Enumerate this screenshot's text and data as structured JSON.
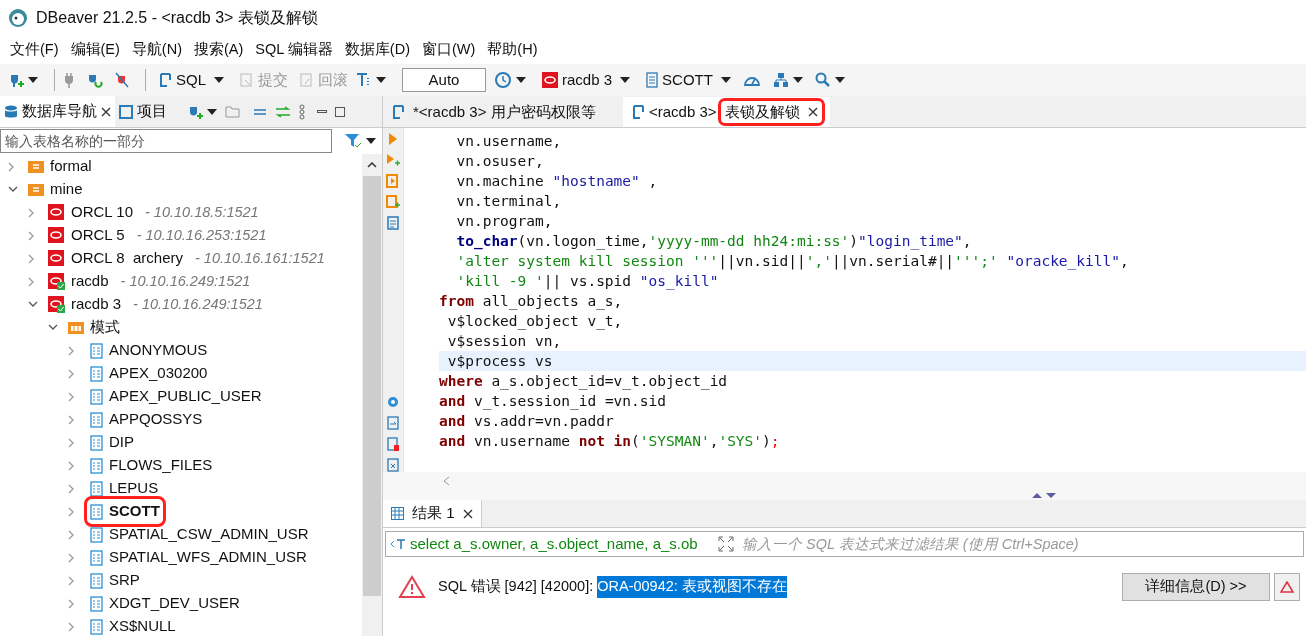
{
  "window": {
    "title": "DBeaver 21.2.5 - <racdb 3> 表锁及解锁"
  },
  "menu": [
    "文件(F)",
    "编辑(E)",
    "导航(N)",
    "搜索(A)",
    "SQL 编辑器",
    "数据库(D)",
    "窗口(W)",
    "帮助(H)"
  ],
  "toolbar": [
    {
      "kind": "icon",
      "dropdown": true
    },
    {
      "kind": "separator"
    },
    {
      "kind": "icon",
      "dropdown": false
    },
    {
      "kind": "icon",
      "dropdown": false
    },
    {
      "kind": "icon",
      "dropdown": false
    },
    {
      "kind": "separator"
    },
    {
      "kind": "button",
      "label": "SQL",
      "disabled": false,
      "dropdown": true
    },
    {
      "kind": "button",
      "label": "提交",
      "disabled": true,
      "dropdown": false
    },
    {
      "kind": "button",
      "label": "回滚",
      "disabled": true,
      "dropdown": false
    },
    {
      "kind": "icon",
      "dropdown": true
    },
    {
      "kind": "field",
      "label": "Auto"
    },
    {
      "kind": "icon",
      "dropdown": true
    },
    {
      "kind": "button",
      "label": "racdb 3",
      "disabled": false,
      "dropdown": true
    },
    {
      "kind": "button",
      "label": "SCOTT",
      "disabled": false,
      "dropdown": true
    },
    {
      "kind": "icon",
      "dropdown": false
    },
    {
      "kind": "icon",
      "dropdown": true
    },
    {
      "kind": "icon",
      "dropdown": true
    }
  ],
  "navigator": {
    "tabs": [
      {
        "label": "数据库导航",
        "selected": true
      },
      {
        "label": "项目",
        "selected": false
      }
    ],
    "filter": {
      "placeholder": "输入表格名称的一部分"
    },
    "tree": [
      {
        "kind": "folder",
        "label": "formal",
        "expanded": false
      },
      {
        "kind": "folder",
        "label": "mine",
        "expanded": true,
        "children": [
          {
            "kind": "connection",
            "label": "ORCL 10",
            "detail": "- 10.10.18.5:1521",
            "connected": false,
            "expanded": false
          },
          {
            "kind": "connection",
            "label": "ORCL 5",
            "detail": "- 10.10.16.253:1521",
            "connected": false,
            "expanded": false
          },
          {
            "kind": "connection",
            "label": "ORCL 8  archery",
            "detail": "- 10.10.16.161:1521",
            "connected": false,
            "expanded": false
          },
          {
            "kind": "connection",
            "label": "racdb",
            "detail": "- 10.10.16.249:1521",
            "connected": true,
            "expanded": false
          },
          {
            "kind": "connection",
            "label": "racdb 3",
            "detail": "- 10.10.16.249:1521",
            "connected": true,
            "expanded": true,
            "children": [
              {
                "kind": "schemas",
                "label": "模式",
                "expanded": true,
                "children": [
                  {
                    "kind": "schema",
                    "label": "ANONYMOUS",
                    "selected": false,
                    "highlighted": false
                  },
                  {
                    "kind": "schema",
                    "label": "APEX_030200",
                    "selected": false,
                    "highlighted": false
                  },
                  {
                    "kind": "schema",
                    "label": "APEX_PUBLIC_USER",
                    "selected": false,
                    "highlighted": false
                  },
                  {
                    "kind": "schema",
                    "label": "APPQOSSYS",
                    "selected": false,
                    "highlighted": false
                  },
                  {
                    "kind": "schema",
                    "label": "DIP",
                    "selected": false,
                    "highlighted": false
                  },
                  {
                    "kind": "schema",
                    "label": "FLOWS_FILES",
                    "selected": false,
                    "highlighted": false
                  },
                  {
                    "kind": "schema",
                    "label": "LEPUS",
                    "selected": false,
                    "highlighted": false
                  },
                  {
                    "kind": "schema",
                    "label": "SCOTT",
                    "selected": true,
                    "highlighted": true
                  },
                  {
                    "kind": "schema",
                    "label": "SPATIAL_CSW_ADMIN_USR",
                    "selected": false,
                    "highlighted": false
                  },
                  {
                    "kind": "schema",
                    "label": "SPATIAL_WFS_ADMIN_USR",
                    "selected": false,
                    "highlighted": false
                  },
                  {
                    "kind": "schema",
                    "label": "SRP",
                    "selected": false,
                    "highlighted": false
                  },
                  {
                    "kind": "schema",
                    "label": "XDGT_DEV_USER",
                    "selected": false,
                    "highlighted": false
                  },
                  {
                    "kind": "schema",
                    "label": "XS$NULL",
                    "selected": false,
                    "highlighted": false
                  }
                ]
              }
            ]
          }
        ]
      }
    ]
  },
  "editor_tabs": [
    {
      "label": "*<racdb 3> 用户密码权限等",
      "selected": false,
      "highlighted": false
    },
    {
      "label": "<racdb 3>",
      "label_2": "表锁及解锁",
      "selected": true,
      "highlighted": true
    }
  ],
  "code": [
    {
      "current": false,
      "segments": [
        {
          "kind": "plain",
          "text": "  vn.username,"
        }
      ]
    },
    {
      "current": false,
      "segments": [
        {
          "kind": "plain",
          "text": "  vn.osuser,"
        }
      ]
    },
    {
      "current": false,
      "segments": [
        {
          "kind": "plain",
          "text": "  vn.machine "
        },
        {
          "kind": "quoted",
          "text": "\"hostname\""
        },
        {
          "kind": "plain",
          "text": " ,"
        }
      ]
    },
    {
      "current": false,
      "segments": [
        {
          "kind": "plain",
          "text": "  vn.terminal,"
        }
      ]
    },
    {
      "current": false,
      "segments": [
        {
          "kind": "plain",
          "text": "  vn.program,"
        }
      ]
    },
    {
      "current": false,
      "segments": [
        {
          "kind": "function",
          "text": "  to_char"
        },
        {
          "kind": "plain",
          "text": "(vn.logon_time,"
        },
        {
          "kind": "string",
          "text": "'yyyy-mm-dd hh24:mi:ss'"
        },
        {
          "kind": "plain",
          "text": ")"
        },
        {
          "kind": "quoted",
          "text": "\"login_time\""
        },
        {
          "kind": "plain",
          "text": ","
        }
      ]
    },
    {
      "current": false,
      "segments": [
        {
          "kind": "string",
          "text": "  'alter system kill session '''"
        },
        {
          "kind": "plain",
          "text": "||vn.sid||"
        },
        {
          "kind": "string",
          "text": "','"
        },
        {
          "kind": "plain",
          "text": "||vn.serial#||"
        },
        {
          "kind": "string",
          "text": "''';'"
        },
        {
          "kind": "quoted",
          "text": " \"oracke_kill\""
        },
        {
          "kind": "plain",
          "text": ","
        }
      ]
    },
    {
      "current": false,
      "segments": [
        {
          "kind": "string",
          "text": "  'kill -9 '"
        },
        {
          "kind": "plain",
          "text": "|| vs.spid "
        },
        {
          "kind": "quoted",
          "text": "\"os_kill\""
        }
      ]
    },
    {
      "current": false,
      "segments": [
        {
          "kind": "keyword",
          "text": "from"
        },
        {
          "kind": "plain",
          "text": " all_objects a_s,"
        }
      ]
    },
    {
      "current": false,
      "segments": [
        {
          "kind": "plain",
          "text": " v$locked_object v_t,"
        }
      ]
    },
    {
      "current": false,
      "segments": [
        {
          "kind": "plain",
          "text": " v$session vn,"
        }
      ]
    },
    {
      "current": true,
      "segments": [
        {
          "kind": "plain",
          "text": " v$process vs"
        }
      ]
    },
    {
      "current": false,
      "segments": [
        {
          "kind": "keyword",
          "text": "where"
        },
        {
          "kind": "plain",
          "text": " a_s.object_id=v_t.object_id"
        }
      ]
    },
    {
      "current": false,
      "segments": [
        {
          "kind": "keyword",
          "text": "and"
        },
        {
          "kind": "plain",
          "text": " v_t.session_id =vn.sid"
        }
      ]
    },
    {
      "current": false,
      "segments": [
        {
          "kind": "keyword",
          "text": "and"
        },
        {
          "kind": "plain",
          "text": " vs.addr=vn.paddr"
        }
      ]
    },
    {
      "current": false,
      "segments": [
        {
          "kind": "keyword",
          "text": "and"
        },
        {
          "kind": "plain",
          "text": " vn.username "
        },
        {
          "kind": "keyword",
          "text": "not in"
        },
        {
          "kind": "plain",
          "text": "("
        },
        {
          "kind": "string",
          "text": "'SYSMAN'"
        },
        {
          "kind": "plain",
          "text": ","
        },
        {
          "kind": "string",
          "text": "'SYS'"
        },
        {
          "kind": "plain",
          "text": ")"
        },
        {
          "kind": "error",
          "text": ";"
        }
      ]
    }
  ],
  "results": {
    "tabs": [
      {
        "label": "结果 1",
        "selected": true
      }
    ],
    "query": "select a_s.owner, a_s.object_name, a_s.ob",
    "filter": {
      "placeholder": "输入一个 SQL 表达式来过滤结果 (使用 Ctrl+Space)"
    },
    "error": {
      "prefix": "SQL 错误 [942] [42000]:",
      "message": "ORA-00942: 表或视图不存在",
      "message_selected": true
    },
    "details_button": "详细信息(D) >>"
  }
}
